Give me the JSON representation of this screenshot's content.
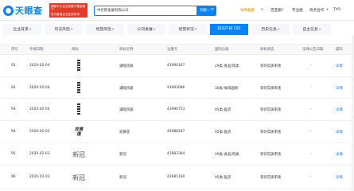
{
  "header": {
    "logo_text": "天眼查",
    "promo_line1": "国家中小企业发展子基金旗下",
    "promo_line2": "官方备案企业征信机构",
    "search_value": "中农新发展有限公司",
    "search_button": "天眼一下",
    "vip": "VIP会员",
    "nav": [
      "百宝箱",
      "专业版",
      "商务合作",
      "TYO"
    ]
  },
  "tabs": [
    {
      "label": "企业背景",
      "count": ""
    },
    {
      "label": "司法风险",
      "count": ""
    },
    {
      "label": "经营风险",
      "count": ""
    },
    {
      "label": "公司发展",
      "count": ""
    },
    {
      "label": "经营状况",
      "count": ""
    },
    {
      "label": "知识产权",
      "count": "102"
    },
    {
      "label": "历史信息",
      "count": ""
    },
    {
      "label": "自主信息",
      "count": ""
    }
  ],
  "table": {
    "headers": [
      "序号",
      "申请日期",
      "商标",
      "商标名称",
      "注册号",
      "国际分类",
      "商标状态",
      "法律公告日期",
      "操作"
    ],
    "rows": [
      {
        "index": "91",
        "date": "2020-02-04",
        "mark": "bars",
        "name": "满陇热蔬",
        "reg_no": "43994167",
        "class": "29类-食品/肉类",
        "status": "等待实质审查",
        "notice": "-",
        "action": "详情"
      },
      {
        "index": "92",
        "date": "2020-02-04",
        "mark": "bars",
        "name": "满陇热蔬",
        "reg_no": "43993086",
        "class": "30类-咖啡面粉",
        "status": "等待实质审查",
        "notice": "-",
        "action": "详情"
      },
      {
        "index": "93",
        "date": "2020-02-04",
        "mark": "bars",
        "name": "满陇热蔬",
        "reg_no": "43990753",
        "class": "05类-医药",
        "status": "等待实质审查",
        "notice": "-",
        "action": "详情"
      },
      {
        "index": "94",
        "date": "2020-02-03",
        "mark": "script",
        "mark_text": "双黄莲",
        "name": "双黄莲",
        "reg_no": "43988287",
        "class": "05类-医药",
        "status": "等待实质审查",
        "notice": "-",
        "action": "详情"
      },
      {
        "index": "95",
        "date": "2020-02-03",
        "mark": "big",
        "mark_text": "新冠",
        "name": "新冠",
        "reg_no": "43983364",
        "class": "29类-食品/肉类",
        "status": "等待实质审查",
        "notice": "-",
        "action": "详情"
      },
      {
        "index": "96",
        "date": "2020-02-03",
        "mark": "big",
        "mark_text": "新冠",
        "name": "新冠",
        "reg_no": "43981160",
        "class": "05类-医药",
        "status": "等待实质审查",
        "notice": "-",
        "action": "详情"
      }
    ]
  }
}
